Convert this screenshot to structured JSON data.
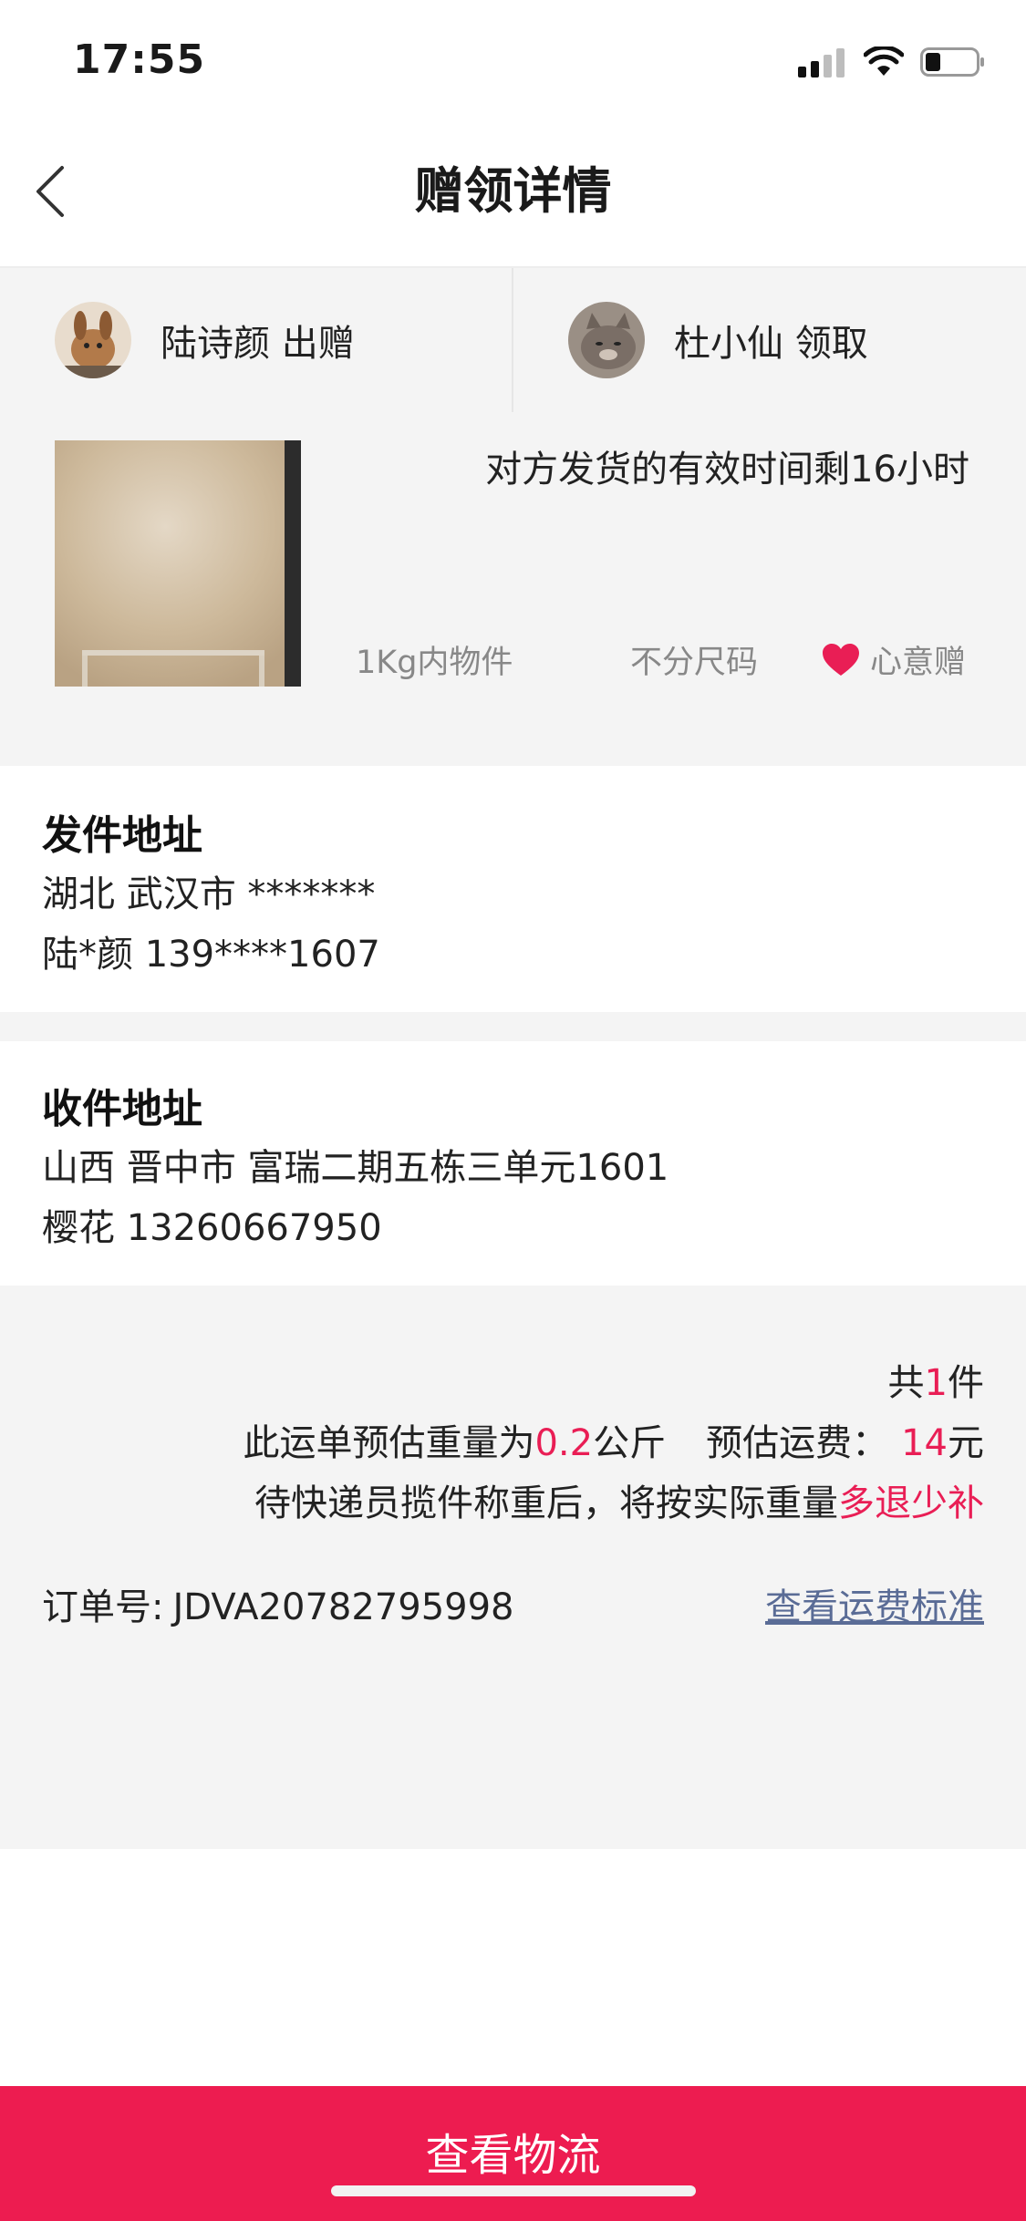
{
  "status": {
    "time": "17:55"
  },
  "nav": {
    "title": "赠领详情"
  },
  "giver": {
    "label": "陆诗颜 出赠"
  },
  "receiver": {
    "label": "杜小仙 领取"
  },
  "product": {
    "timer": "对方发货的有效时间剩16小时",
    "weight_tag": "1Kg内物件",
    "size_tag": "不分尺码",
    "gift_tag": "心意赠"
  },
  "sender": {
    "title": "发件地址",
    "address": "湖北 武汉市 *******",
    "contact": "陆*颜 139****1607"
  },
  "recipient": {
    "title": "收件地址",
    "address": "山西 晋中市 富瑞二期五栋三单元1601",
    "contact": "樱花 13260667950"
  },
  "summary": {
    "count_prefix": "共",
    "count": "1",
    "count_suffix": "件",
    "weight_prefix": "此运单预估重量为",
    "weight": "0.2",
    "weight_unit": "公斤",
    "fee_label": "预估运费：",
    "fee": "14",
    "fee_unit": "元",
    "note_prefix": "待快递员揽件称重后，将按实际重量",
    "note_highlight": "多退少补",
    "order_label": "订单号:",
    "order_no": "JDVA20782795998",
    "rate_link": "查看运费标准"
  },
  "footer": {
    "button": "查看物流"
  },
  "colors": {
    "accent": "#ed1c50",
    "link": "#5a6c96",
    "highlight": "#e91e55"
  }
}
